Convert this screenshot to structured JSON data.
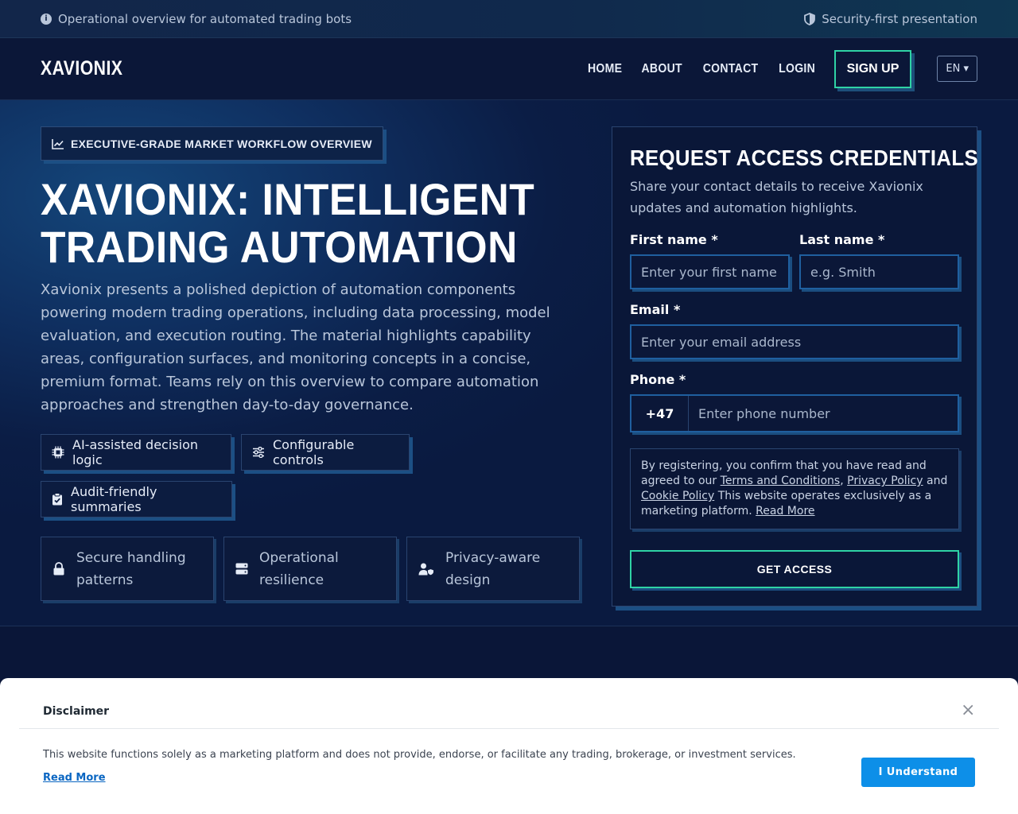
{
  "topbar": {
    "left_text": "Operational overview for automated trading bots",
    "right_text": "Security-first presentation"
  },
  "nav": {
    "logo": "XAVIONIX",
    "links": [
      "HOME",
      "ABOUT",
      "CONTACT",
      "LOGIN"
    ],
    "signup_label": "SIGN UP",
    "language": "EN ▾"
  },
  "hero": {
    "badge": "EXECUTIVE-GRADE MARKET WORKFLOW OVERVIEW",
    "title": "XAVIONIX: INTELLIGENT TRADING AUTOMATION",
    "description": "Xavionix presents a polished depiction of automation components powering modern trading operations, including data processing, model evaluation, and execution routing. The material highlights capability areas, configuration surfaces, and monitoring concepts in a concise, premium format. Teams rely on this overview to compare automation approaches and strengthen day-to-day governance.",
    "chips": [
      "AI-assisted decision logic",
      "Configurable controls",
      "Audit-friendly summaries"
    ],
    "features": [
      "Secure handling patterns",
      "Operational resilience",
      "Privacy-aware design"
    ]
  },
  "form": {
    "title": "REQUEST ACCESS CREDENTIALS",
    "subtitle": "Share your contact details to receive Xavionix updates and automation highlights.",
    "first_name_label": "First name *",
    "first_name_placeholder": "Enter your first name",
    "last_name_label": "Last name *",
    "last_name_placeholder": "e.g. Smith",
    "email_label": "Email *",
    "email_placeholder": "Enter your email address",
    "phone_label": "Phone *",
    "phone_code": "+47",
    "phone_placeholder": "Enter phone number",
    "consent": {
      "part1": "By registering, you confirm that you have read and agreed to our ",
      "terms": "Terms and Conditions",
      "sep": ", ",
      "privacy": "Privacy Policy",
      "and": " and ",
      "cookie": "Cookie Policy",
      "part2": " This website operates exclusively as a marketing platform. ",
      "read_more": "Read More"
    },
    "submit_label": "GET ACCESS"
  },
  "disclaimer": {
    "title": "Disclaimer",
    "close": "×",
    "text": "This website functions solely as a marketing platform and does not provide, endorse, or facilitate any trading, brokerage, or investment services.",
    "read_more": "Read More",
    "button": "I Understand"
  }
}
